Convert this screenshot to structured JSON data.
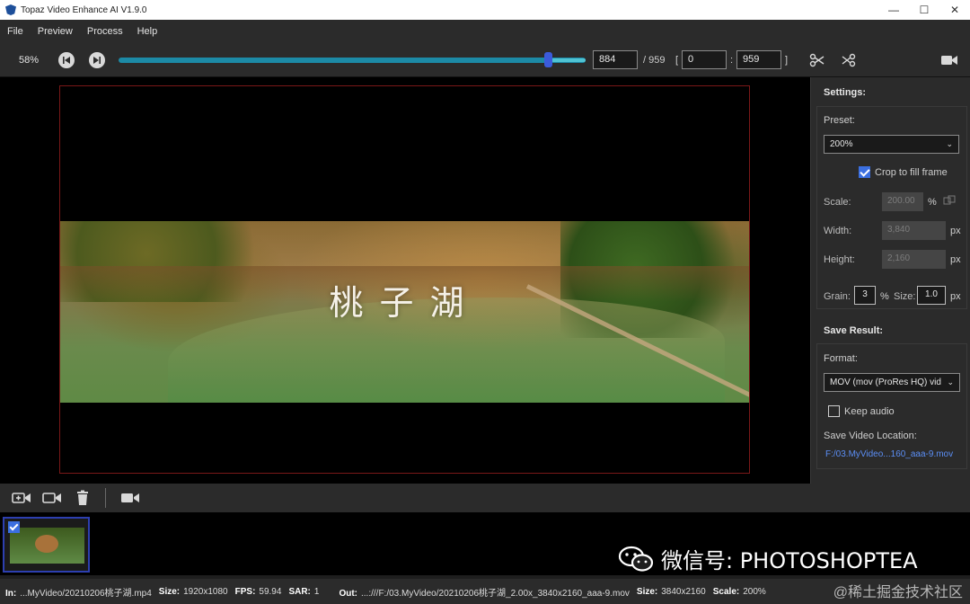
{
  "window": {
    "title": "Topaz Video Enhance AI V1.9.0",
    "minimize": "—",
    "maximize": "☐",
    "close": "✕"
  },
  "menu": [
    "File",
    "Preview",
    "Process",
    "Help"
  ],
  "transport": {
    "zoom": "58%",
    "current_frame": "884",
    "total_frames": "/ 959",
    "range_open": "[",
    "range_start": "0",
    "range_sep": ":",
    "range_end": "959",
    "range_close": "]",
    "progress_fraction": 0.92
  },
  "preview": {
    "caption": "桃子湖"
  },
  "settings": {
    "title": "Settings:",
    "preset_label": "Preset:",
    "preset_value": "200%",
    "crop_label": "Crop to fill frame",
    "crop_checked": true,
    "scale_label": "Scale:",
    "scale_value": "200.00",
    "scale_unit": "%",
    "width_label": "Width:",
    "width_value": "3,840",
    "width_unit": "px",
    "height_label": "Height:",
    "height_value": "2,160",
    "height_unit": "px",
    "grain_label": "Grain:",
    "grain_value": "3",
    "grain_unit": "%",
    "size_label": "Size:",
    "size_value": "1.0",
    "size_unit": "px"
  },
  "save": {
    "title": "Save Result:",
    "format_label": "Format:",
    "format_value": "MOV (mov (ProRes HQ) vid",
    "keep_audio_label": "Keep audio",
    "keep_audio_checked": false,
    "location_label": "Save Video Location:",
    "location_value": "F:/03.MyVideo...160_aaa-9.mov"
  },
  "status": {
    "in_label": "In:",
    "in_value": "...MyVideo/20210206桃子湖.mp4",
    "size_label": "Size:",
    "size_value": "1920x1080",
    "fps_label": "FPS:",
    "fps_value": "59.94",
    "sar_label": "SAR:",
    "sar_value": "1",
    "out_label": "Out:",
    "out_value": "...:///F:/03.MyVideo/20210206桃子湖_2.00x_3840x2160_aaa-9.mov",
    "out_size_label": "Size:",
    "out_size_value": "3840x2160",
    "scale_label": "Scale:",
    "scale_value": "200%"
  },
  "watermarks": {
    "wechat": "微信号: PHOTOSHOPTEA",
    "community": "@稀土掘金技术社区"
  },
  "colors": {
    "accent": "#3b6fe0",
    "slider": "#1c8aa6",
    "link": "#5b8ef5",
    "frame_border": "#7a1818"
  },
  "icons": {
    "prev_frame": "skip-back-icon",
    "next_frame": "skip-forward-icon",
    "cut": "scissors-icon",
    "cut_alt": "scissors-split-icon",
    "camera": "video-camera-icon"
  }
}
